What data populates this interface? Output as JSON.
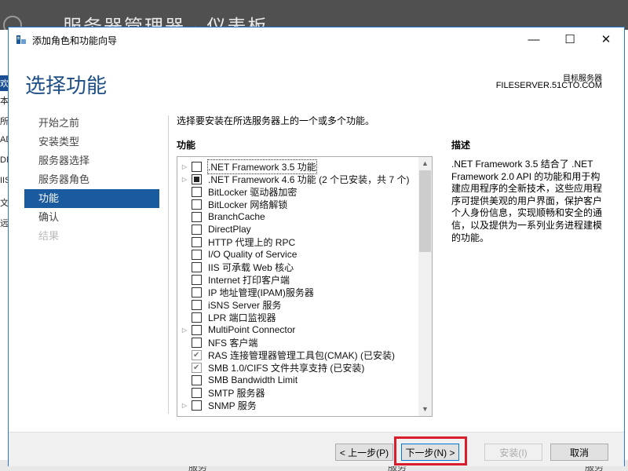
{
  "background": {
    "title": "服务器管理器 · 仪表板",
    "left_fragments": [
      "欢",
      "本地",
      "所有",
      "AD",
      "DN",
      "IIS",
      "文件",
      "远程"
    ],
    "bottom_fragments": [
      "服务",
      "服务",
      "服务"
    ]
  },
  "dialog": {
    "title": "添加角色和功能向导",
    "page_heading": "选择功能",
    "target_label": "目标服务器",
    "target_server": "FILESERVER.51CTO.COM",
    "window_buttons": {
      "minimize": "—",
      "maximize": "☐",
      "close": "✕"
    }
  },
  "nav": {
    "items": [
      {
        "label": "开始之前",
        "state": "normal"
      },
      {
        "label": "安装类型",
        "state": "normal"
      },
      {
        "label": "服务器选择",
        "state": "normal"
      },
      {
        "label": "服务器角色",
        "state": "normal"
      },
      {
        "label": "功能",
        "state": "active"
      },
      {
        "label": "确认",
        "state": "normal"
      },
      {
        "label": "结果",
        "state": "disabled"
      }
    ]
  },
  "content": {
    "instruction": "选择要安装在所选服务器上的一个或多个功能。",
    "features_label": "功能",
    "description_label": "描述",
    "description_text": ".NET Framework 3.5 结合了 .NET Framework 2.0 API 的功能和用于构建应用程序的全新技术，这些应用程序可提供美观的用户界面，保护客户个人身份信息，实现顺畅和安全的通信，以及提供为一系列业务进程建模的功能。",
    "features": [
      {
        "label": ".NET Framework 3.5 功能",
        "expander": true,
        "state": "unchecked",
        "selected": true
      },
      {
        "label": ".NET Framework 4.6 功能 (2 个已安装，共 7 个)",
        "expander": true,
        "state": "partial"
      },
      {
        "label": "BitLocker 驱动器加密",
        "expander": false,
        "state": "unchecked"
      },
      {
        "label": "BitLocker 网络解锁",
        "expander": false,
        "state": "unchecked"
      },
      {
        "label": "BranchCache",
        "expander": false,
        "state": "unchecked"
      },
      {
        "label": "DirectPlay",
        "expander": false,
        "state": "unchecked"
      },
      {
        "label": "HTTP 代理上的 RPC",
        "expander": false,
        "state": "unchecked"
      },
      {
        "label": "I/O Quality of Service",
        "expander": false,
        "state": "unchecked"
      },
      {
        "label": "IIS 可承载 Web 核心",
        "expander": false,
        "state": "unchecked"
      },
      {
        "label": "Internet 打印客户端",
        "expander": false,
        "state": "unchecked"
      },
      {
        "label": "IP 地址管理(IPAM)服务器",
        "expander": false,
        "state": "unchecked"
      },
      {
        "label": "iSNS Server 服务",
        "expander": false,
        "state": "unchecked"
      },
      {
        "label": "LPR 端口监视器",
        "expander": false,
        "state": "unchecked"
      },
      {
        "label": "MultiPoint Connector",
        "expander": true,
        "state": "unchecked"
      },
      {
        "label": "NFS 客户端",
        "expander": false,
        "state": "unchecked"
      },
      {
        "label": "RAS 连接管理器管理工具包(CMAK) (已安装)",
        "expander": false,
        "state": "checked"
      },
      {
        "label": "SMB 1.0/CIFS 文件共享支持 (已安装)",
        "expander": false,
        "state": "checked"
      },
      {
        "label": "SMB Bandwidth Limit",
        "expander": false,
        "state": "unchecked"
      },
      {
        "label": "SMTP 服务器",
        "expander": false,
        "state": "unchecked"
      },
      {
        "label": "SNMP 服务",
        "expander": true,
        "state": "unchecked"
      }
    ]
  },
  "footer": {
    "prev_label": "< 上一步(P)",
    "next_label": "下一步(N) >",
    "install_label": "安装(I)",
    "cancel_label": "取消"
  },
  "colors": {
    "accent": "#1a5a9e",
    "heading": "#1e4e86",
    "highlight_box": "#d81e2a"
  },
  "icons": {
    "title_icon": "server-manager-icon",
    "back": "back-arrow-icon"
  }
}
